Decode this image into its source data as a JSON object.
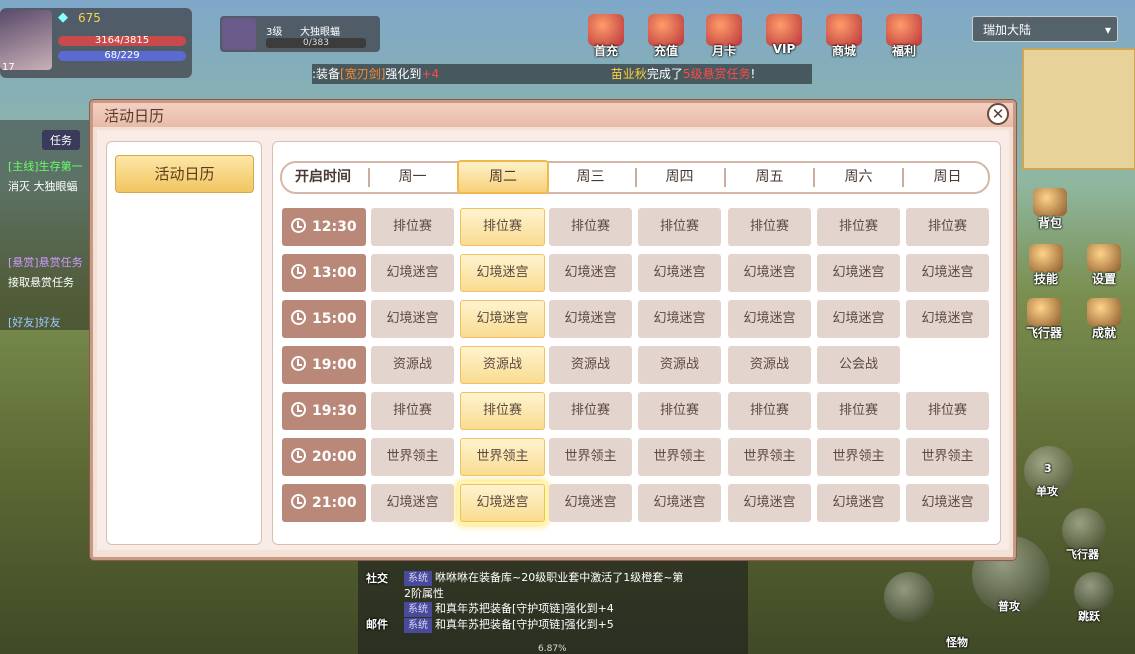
{
  "player": {
    "level": "17",
    "gold": "675",
    "hp": "3164/3815",
    "mp": "68/229"
  },
  "pet": {
    "level": "3级",
    "name": "大独眼蝠",
    "exp": "0/383"
  },
  "marquee": {
    "part1": ":装备",
    "item1": "[宽刃剑]",
    "part2": "强化到",
    "plus1": "+4",
    "name2": "苗业秋",
    "part3": "完成了",
    "task": "5级悬赏任务",
    "part4": "!"
  },
  "top_icons": [
    "首充",
    "充值",
    "月卡",
    "VIP",
    "商城",
    "福利"
  ],
  "map_selector": "瑞加大陆",
  "side_icons": [
    "背包",
    "技能",
    "设置",
    "飞行器",
    "成就"
  ],
  "left_panel": {
    "tab": "任务",
    "quest1": "[主线]生存第一",
    "quest1_desc": "消灭 大独眼蝠",
    "quest2": "[悬赏]悬赏任务",
    "quest2_desc": "接取悬赏任务",
    "quest3": "[好友]好友"
  },
  "chat": {
    "social": "社交",
    "mail": "邮件",
    "lines": [
      {
        "tag": "系统",
        "text": "咻咻咻在装备库~20级职业套中激活了1级橙套~第"
      },
      {
        "tag": "",
        "text": "2阶属性"
      },
      {
        "tag": "系统",
        "text": "和真年苏把装备[守护项链]强化到+4"
      },
      {
        "tag": "系统",
        "text": "和真年苏把装备[守护项链]强化到+5"
      }
    ],
    "exp_percent": "6.87%"
  },
  "combat": {
    "single": "单攻",
    "single_count": "3",
    "normal": "普攻",
    "fly": "飞行器",
    "jump": "跳跃",
    "monster": "怪物"
  },
  "dialog": {
    "title": "活动日历",
    "left_tab": "活动日历",
    "open_time_label": "开启时间",
    "days": [
      "周一",
      "周二",
      "周三",
      "周四",
      "周五",
      "周六",
      "周日"
    ],
    "selected_day_index": 1,
    "schedule": [
      {
        "time": "12:30",
        "events": [
          "排位赛",
          "排位赛",
          "排位赛",
          "排位赛",
          "排位赛",
          "排位赛",
          "排位赛"
        ]
      },
      {
        "time": "13:00",
        "events": [
          "幻境迷宫",
          "幻境迷宫",
          "幻境迷宫",
          "幻境迷宫",
          "幻境迷宫",
          "幻境迷宫",
          "幻境迷宫"
        ]
      },
      {
        "time": "15:00",
        "events": [
          "幻境迷宫",
          "幻境迷宫",
          "幻境迷宫",
          "幻境迷宫",
          "幻境迷宫",
          "幻境迷宫",
          "幻境迷宫"
        ]
      },
      {
        "time": "19:00",
        "events": [
          "资源战",
          "资源战",
          "资源战",
          "资源战",
          "资源战",
          "公会战",
          ""
        ]
      },
      {
        "time": "19:30",
        "events": [
          "排位赛",
          "排位赛",
          "排位赛",
          "排位赛",
          "排位赛",
          "排位赛",
          "排位赛"
        ]
      },
      {
        "time": "20:00",
        "events": [
          "世界领主",
          "世界领主",
          "世界领主",
          "世界领主",
          "世界领主",
          "世界领主",
          "世界领主"
        ]
      },
      {
        "time": "21:00",
        "events": [
          "幻境迷宫",
          "幻境迷宫",
          "幻境迷宫",
          "幻境迷宫",
          "幻境迷宫",
          "幻境迷宫",
          "幻境迷宫"
        ]
      }
    ],
    "current_slot": {
      "row": 6,
      "col": 1
    }
  },
  "colors": {
    "time_cell": "#b98878",
    "event_cell": "#e3d4cd",
    "selected": "#f9dc91",
    "dialog_bg": "#f4e1d6"
  }
}
